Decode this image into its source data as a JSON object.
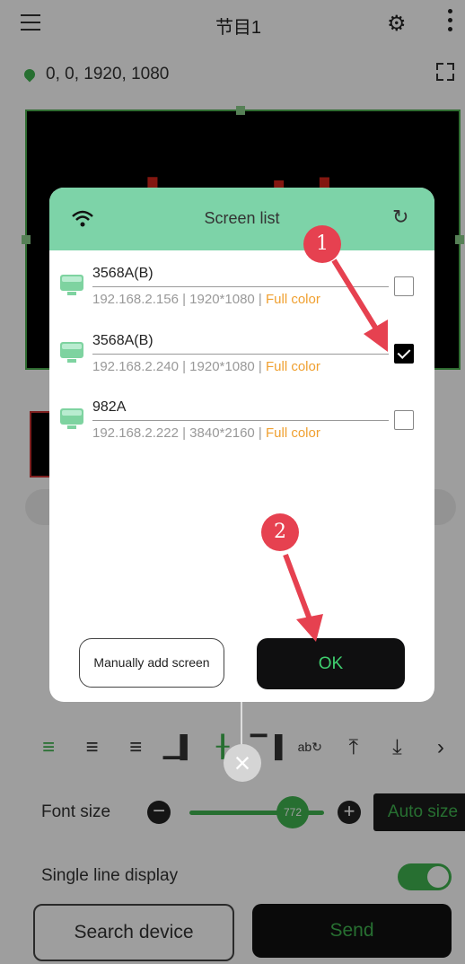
{
  "app": {
    "title": "节目1",
    "coords": "0,  0,  1920,  1080",
    "preview_chars": [
      "去",
      "片"
    ],
    "font_size_label": "Font size",
    "font_size_value": "772",
    "auto_size_label": "Auto size",
    "single_line_label": "Single line display",
    "search_device_label": "Search device",
    "send_label": "Send",
    "toolbar_icons": [
      "align-left-icon",
      "align-center-icon",
      "align-right-icon",
      "align-bottom-icon",
      "align-vcenter-icon",
      "align-top-icon",
      "swap-text-icon",
      "move-top-icon",
      "move-bottom-icon",
      "chevron-right-icon"
    ]
  },
  "dialog": {
    "title": "Screen list",
    "devices": [
      {
        "name": "3568A(B)",
        "ip": "192.168.2.156",
        "resolution": "1920*1080",
        "color": "Full color",
        "checked": false
      },
      {
        "name": "3568A(B)",
        "ip": "192.168.2.240",
        "resolution": "1920*1080",
        "color": "Full color",
        "checked": true
      },
      {
        "name": "982A",
        "ip": "192.168.2.222",
        "resolution": "3840*2160",
        "color": "Full color",
        "checked": false
      }
    ],
    "manual_add_label": "Manually add screen",
    "ok_label": "OK"
  },
  "annotations": {
    "step1": "1",
    "step2": "2"
  },
  "colors": {
    "accent_green": "#3fb34f",
    "dialog_header": "#7dd3a8",
    "annotation_red": "#e64150",
    "color_label": "#f0a030"
  }
}
